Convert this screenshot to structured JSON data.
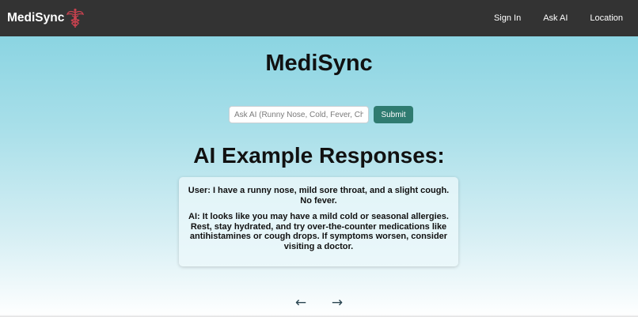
{
  "navbar": {
    "brand": "MediSync",
    "links": [
      "Sign In",
      "Ask AI",
      "Location"
    ]
  },
  "main": {
    "title": "MediSync",
    "ask": {
      "placeholder": "Ask AI (Runny Nose, Cold, Fever, Chest P",
      "submit_label": "Submit"
    },
    "examples_heading": "AI Example Responses:",
    "example": {
      "user": "User: I have a runny nose, mild sore throat, and a slight cough. No fever.",
      "ai": "AI: It looks like you may have a mild cold or seasonal allergies. Rest, stay hydrated, and try over-the-counter medications like antihistamines or cough drops. If symptoms worsen, consider visiting a doctor."
    },
    "carousel": {
      "prev": "←",
      "next": "→"
    }
  },
  "colors": {
    "navbar_bg": "#333333",
    "accent_button": "#2f7b70",
    "logo": "#c8424f",
    "background_top": "#7fd0df"
  },
  "icons": {
    "logo": "caduceus-icon"
  }
}
